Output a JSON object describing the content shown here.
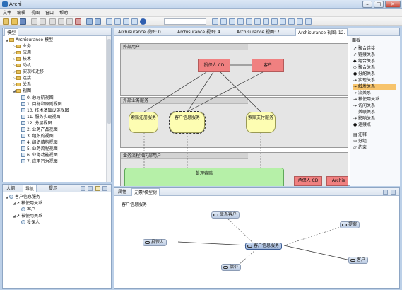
{
  "window": {
    "title": "Archi"
  },
  "menu": [
    "文件",
    "编辑",
    "视图",
    "窗口",
    "帮助"
  ],
  "editor_tabs": [
    "Archisurance 视图: 0.",
    "Archisurance 视图: 4.",
    "Archisurance 视图: 7.",
    "Archisurance 视图: 12."
  ],
  "model": {
    "tab": "模型",
    "root": "Archisurance 模型",
    "folders": [
      "业务",
      "应用",
      "技术",
      "动机",
      "实现和迁移",
      "连接",
      "关系",
      "视图"
    ],
    "views": [
      "0. 总导航视图",
      "1. 目标和原则视图",
      "10. 技术基础设施视图",
      "11. 服务实现视图",
      "12. 分层视图",
      "2. 业务产品视图",
      "3. 组织的视图",
      "4. 组织结构视图",
      "5. 业务流程视图",
      "6. 业务功能视图",
      "7. 应用行为视图"
    ]
  },
  "outline_tabs": [
    "大纲",
    "导航",
    "提示"
  ],
  "navigator": {
    "root": "客户信息服务",
    "items": [
      {
        "label": "被使用关系",
        "level": 1
      },
      {
        "label": "客户",
        "level": 2
      },
      {
        "label": "被使用关系",
        "level": 1
      },
      {
        "label": "投保人",
        "level": 2
      }
    ]
  },
  "palette": {
    "tab": "面板",
    "items": [
      "聚合连接",
      "链接关系",
      "组合关系",
      "聚合关系",
      "分配关系",
      "实现关系",
      "触发关系",
      "流关系",
      "被使用关系",
      "访问关系",
      "关联关系",
      "影响关系",
      "连接点",
      "注释",
      "分组",
      "约束"
    ]
  },
  "canvas": {
    "groups": [
      "外部用户",
      "外部业务服务",
      "业务流程和内部用户"
    ],
    "red_elements": [
      "投保人 CD",
      "客户"
    ],
    "services": [
      "索赔注册服务",
      "客户信息服务",
      "索赔支付服务"
    ],
    "process": "处理索赔",
    "bottom_red": [
      "承保人 CD",
      "Archis"
    ]
  },
  "bottom_tabs": [
    "属性",
    "元素/模型树"
  ],
  "tree": {
    "title": "客户信息服务",
    "nodes": [
      "联系客户",
      "投保人",
      "客户信息服务",
      "提案",
      "客户",
      "估价"
    ]
  }
}
